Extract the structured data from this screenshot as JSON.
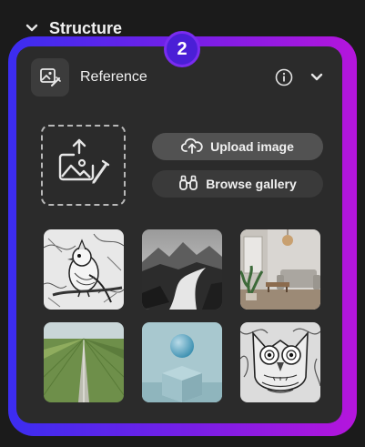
{
  "section": {
    "title": "Structure"
  },
  "step_badge": "2",
  "reference": {
    "title": "Reference",
    "upload_label": "Upload image",
    "browse_label": "Browse gallery"
  },
  "gallery": {
    "thumbnails": [
      "bird-sketch-thumbnail",
      "misty-river-landscape-thumbnail",
      "living-room-interior-thumbnail",
      "road-through-fields-thumbnail",
      "sphere-on-cube-thumbnail",
      "owl-drawing-thumbnail"
    ]
  },
  "colors": {
    "accent_gradient_start": "#3b2df0",
    "accent_gradient_end": "#b515dc",
    "panel_bg": "#2b2b2b",
    "page_bg": "#1b1b1b"
  }
}
